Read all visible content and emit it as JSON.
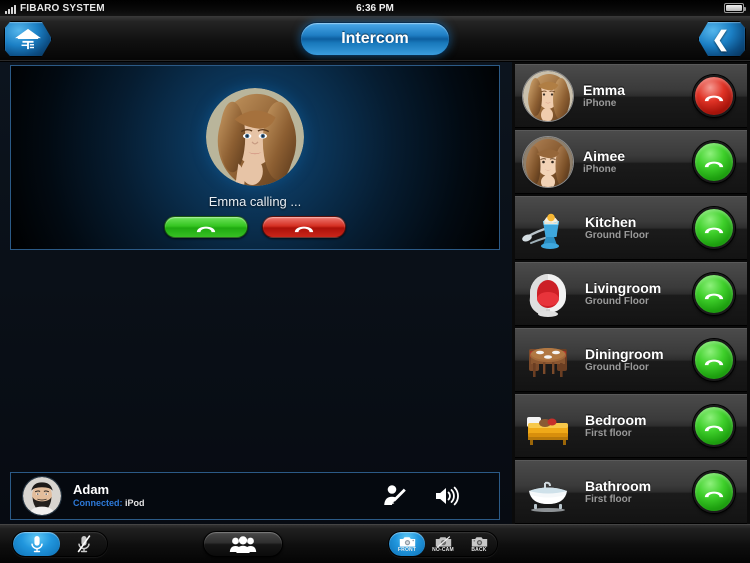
{
  "status_bar": {
    "carrier": "FIBARO SYSTEM",
    "time": "6:36 PM",
    "signal_icon": "signal-bars-icon",
    "battery_icon": "battery-full-icon"
  },
  "nav": {
    "home_button": "fibaro-home-logo",
    "title": "Intercom",
    "back_button": "chevron-left-icon"
  },
  "call_panel": {
    "caller_avatar": "emma-avatar",
    "status_text": "Emma calling ...",
    "accept_label": "accept-call",
    "decline_label": "decline-call",
    "accept_color": "#35c521",
    "decline_color": "#d42f22"
  },
  "user_bar": {
    "avatar": "adam-avatar",
    "name": "Adam",
    "connection_label": "Connected:",
    "connection_device": "iPod",
    "connection_label_color": "#2d79d8",
    "edit_icon": "edit-user-icon",
    "speaker_icon": "speaker-volume-icon"
  },
  "sidebar": {
    "items": [
      {
        "name": "Emma",
        "sub": "iPhone",
        "icon": "emma-photo",
        "icon_type": "photo",
        "call_state": "hangup",
        "call_color": "#e03326"
      },
      {
        "name": "Aimee",
        "sub": "iPhone",
        "icon": "aimee-photo",
        "icon_type": "photo",
        "call_state": "call",
        "call_color": "#3fd02b"
      },
      {
        "name": "Kitchen",
        "sub": "Ground Floor",
        "icon": "eggcup-spoon-icon",
        "icon_type": "room",
        "call_state": "call",
        "call_color": "#3fd02b"
      },
      {
        "name": "Livingroom",
        "sub": "Ground Floor",
        "icon": "egg-chair-icon",
        "icon_type": "room",
        "call_state": "call",
        "call_color": "#3fd02b"
      },
      {
        "name": "Diningroom",
        "sub": "Ground Floor",
        "icon": "dining-table-icon",
        "icon_type": "room",
        "call_state": "call",
        "call_color": "#3fd02b"
      },
      {
        "name": "Bedroom",
        "sub": "First floor",
        "icon": "bed-icon",
        "icon_type": "room",
        "call_state": "call",
        "call_color": "#3fd02b"
      },
      {
        "name": "Bathroom",
        "sub": "First floor",
        "icon": "bathtub-icon",
        "icon_type": "room",
        "call_state": "call",
        "call_color": "#3fd02b"
      }
    ]
  },
  "toolbar": {
    "mic": {
      "on_icon": "microphone-icon",
      "mute_icon": "microphone-muted-icon",
      "active": "on"
    },
    "conference_icon": "people-group-icon",
    "camera": {
      "options": [
        {
          "label": "FRONT",
          "icon": "camera-front-icon",
          "active": true
        },
        {
          "label": "NO-CAM",
          "icon": "camera-off-icon",
          "active": false
        },
        {
          "label": "BACK",
          "icon": "camera-back-icon",
          "active": false
        }
      ]
    },
    "active_color": "#2196dd"
  }
}
